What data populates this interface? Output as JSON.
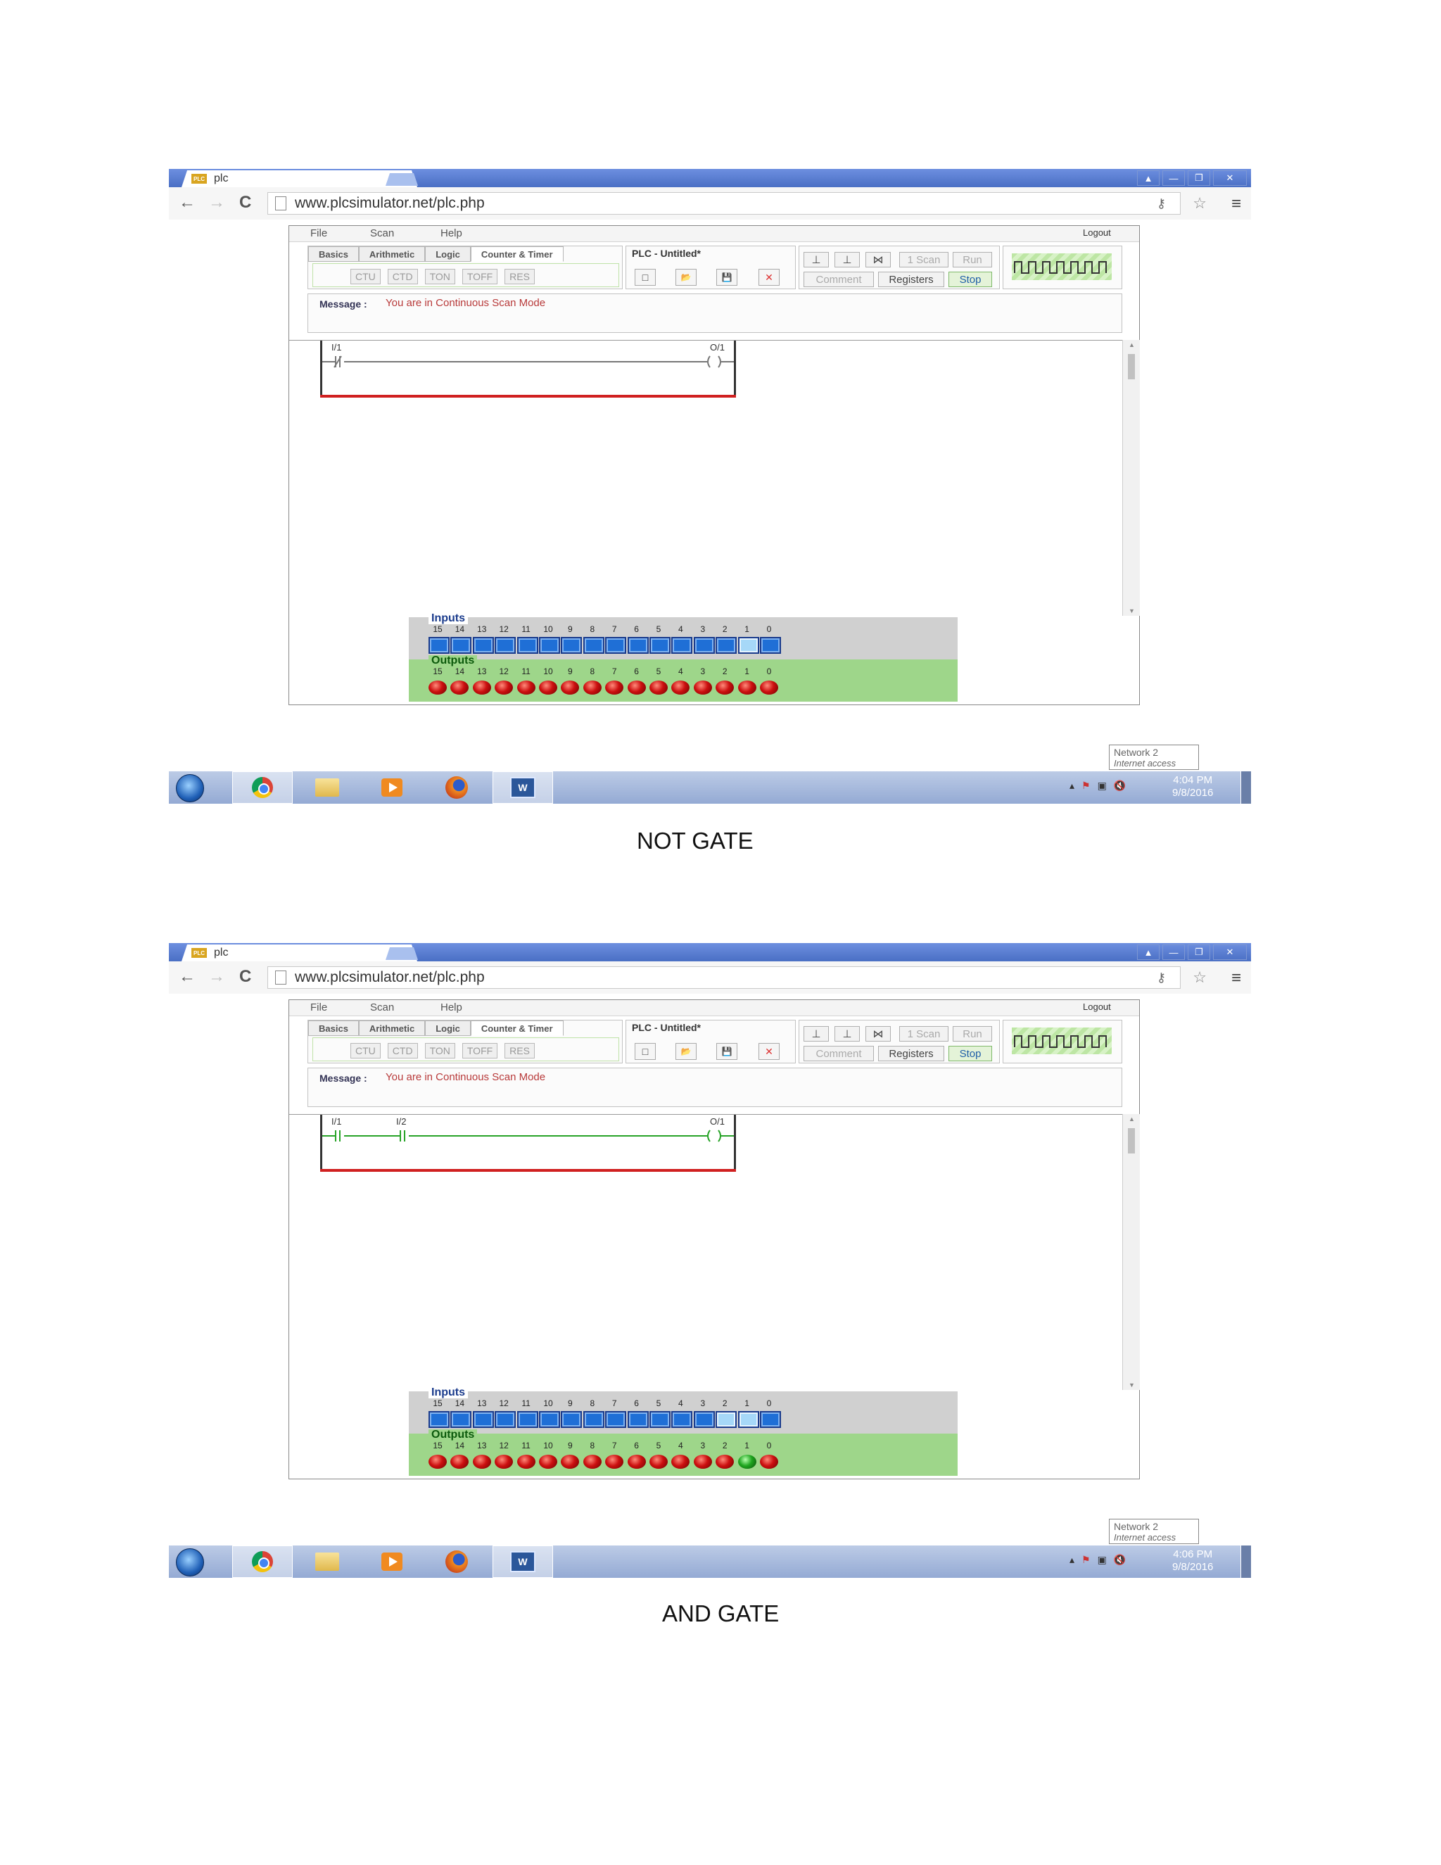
{
  "browser": {
    "tab_title": "plc",
    "tab_close": "×",
    "url": "www.plcsimulator.net/plc.php",
    "win_buttons": [
      "▲",
      "—",
      "❐",
      "✕"
    ],
    "back": "←",
    "forward": "→",
    "reload": "C",
    "key_icon": "key-icon",
    "star_icon": "star-icon",
    "menu_icon": "≡"
  },
  "app": {
    "menu": [
      "File",
      "Scan",
      "Help"
    ],
    "logout": "Logout",
    "tabs": [
      "Basics",
      "Arithmetic",
      "Logic",
      "Counter & Timer"
    ],
    "active_tab": "Counter & Timer",
    "subbuttons": [
      "CTU",
      "CTD",
      "TON",
      "TOFF",
      "RES"
    ],
    "plc_prefix": "PLC - ",
    "plc_name": "Untitled*",
    "file_icons": [
      "□",
      "📂",
      "💾",
      "✕"
    ],
    "controls": {
      "row1": [
        "1 Scan",
        "Run"
      ],
      "row2": [
        "Comment",
        "Registers",
        "Stop"
      ]
    },
    "message_label": "Message :",
    "message_text": "You are in Continuous Scan Mode",
    "io": {
      "inputs_label": "Inputs",
      "outputs_label": "Outputs",
      "numbers": [
        "15",
        "14",
        "13",
        "12",
        "11",
        "10",
        "9",
        "8",
        "7",
        "6",
        "5",
        "4",
        "3",
        "2",
        "1",
        "0"
      ]
    }
  },
  "taskbar": {
    "network_line1": "Network 2",
    "network_line2": "Internet access",
    "tray": [
      "▴",
      "⚑",
      "▣",
      "🔇"
    ]
  },
  "screens": [
    {
      "caption": "NOT  GATE",
      "contacts": [
        "I/1"
      ],
      "coil": "O/1",
      "inputs_on": [
        1
      ],
      "outputs_on": [],
      "time": "4:04 PM",
      "date": "9/8/2016"
    },
    {
      "caption": "AND GATE",
      "contacts": [
        "I/1",
        "I/2"
      ],
      "coil": "O/1",
      "inputs_on": [
        1,
        2
      ],
      "outputs_on": [
        1
      ],
      "time": "4:06 PM",
      "date": "9/8/2016"
    }
  ]
}
